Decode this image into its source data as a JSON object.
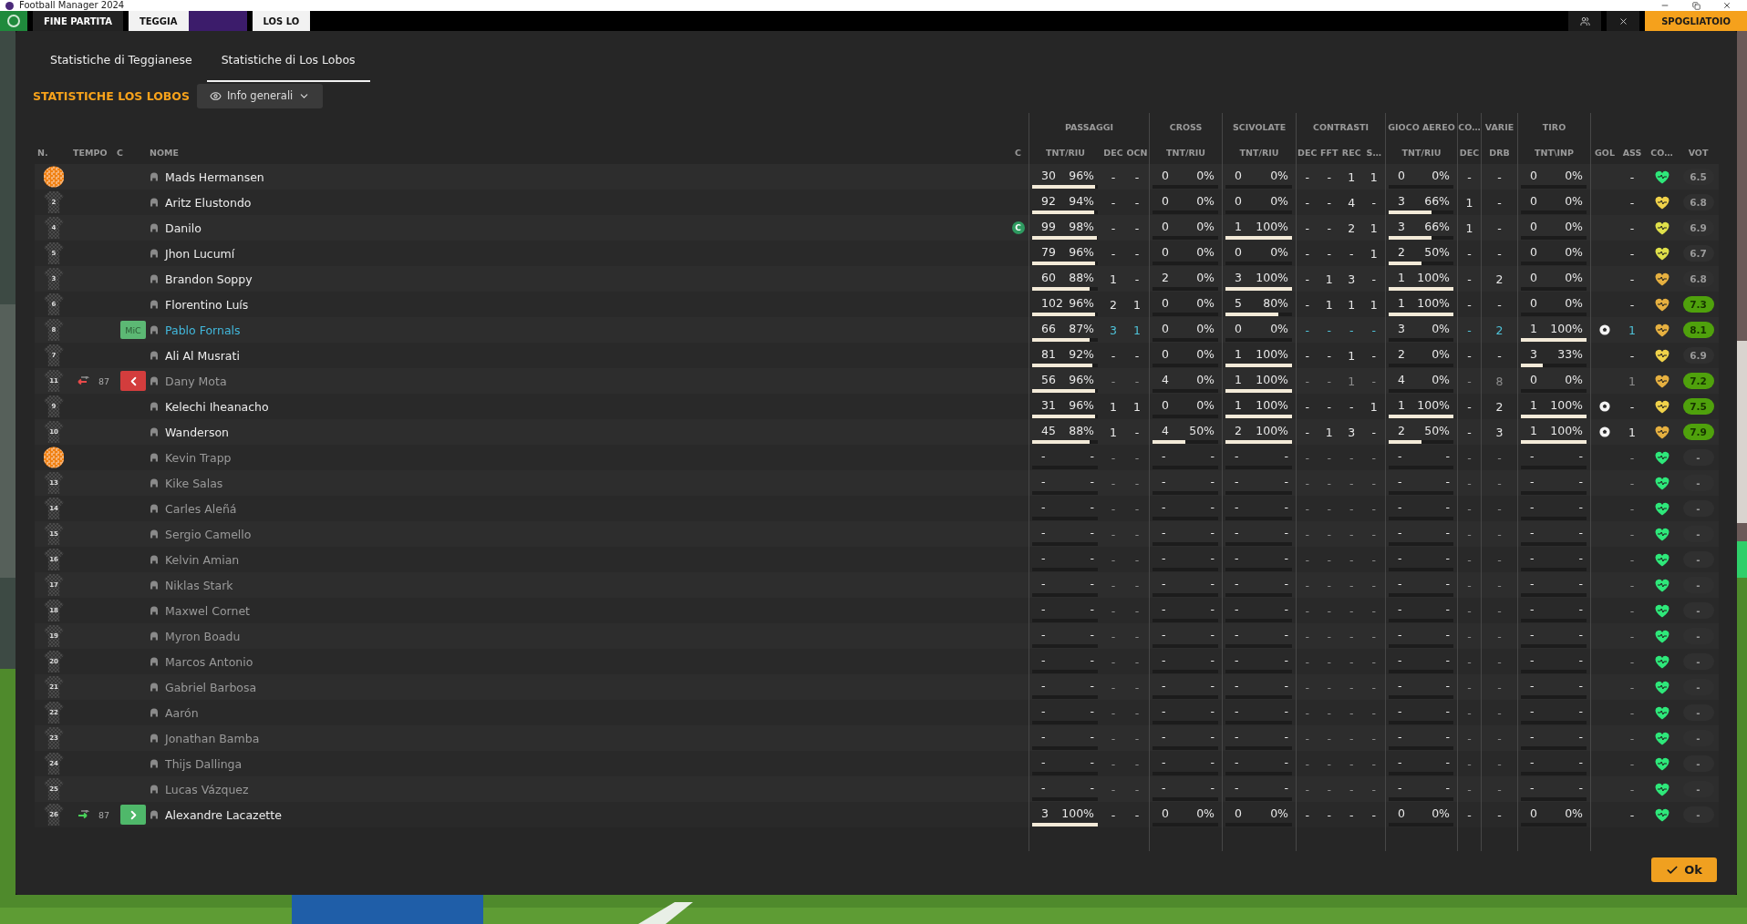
{
  "window": {
    "title": "Football Manager 2024"
  },
  "match_bar": {
    "status": "FINE PARTITA",
    "home_team": "TEGGIA",
    "away_team": "LOS LO",
    "dressing_room_button": "SPOGLIATOIO"
  },
  "tabs": [
    {
      "label": "Statistiche di Teggianese",
      "selected": false
    },
    {
      "label": "Statistiche di Los Lobos",
      "selected": true
    }
  ],
  "section_title": "STATISTICHE LOS LOBOS",
  "view_dropdown": {
    "label": "Info generali"
  },
  "column_groups": [
    "PASSAGGI",
    "CROSS",
    "SCIVOLATE",
    "CONTRASTI",
    "GIOCO AEREO",
    "CO…",
    "VARIE",
    "TIRO"
  ],
  "columns": [
    "N.",
    "TEMPO",
    "C",
    "NOME",
    "C",
    "TNT/RIU",
    "DEC",
    "OCN",
    "TNT/RIU",
    "TNT/RIU",
    "DEC",
    "FFT",
    "REC",
    "S…",
    "TNT/RIU",
    "DEC",
    "DRB",
    "TNT\\INP",
    "GOL",
    "ASS",
    "CO…",
    "VOT"
  ],
  "rows": [
    {
      "shirt": {
        "kind": "goalkeeper"
      },
      "name": "Mads Hermansen",
      "highlighted": false,
      "dimmed": false,
      "passes": {
        "tnt": "30",
        "riu": "96%",
        "level": 0.96
      },
      "dec": "-",
      "ocn": "-",
      "cross": {
        "tnt": "0",
        "riu": "0%",
        "level": 0
      },
      "tackles": {
        "tnt": "0",
        "riu": "0%",
        "level": 0
      },
      "duels": [
        "-",
        "-",
        "1",
        "1"
      ],
      "aerial": {
        "tnt": "0",
        "riu": "0%",
        "level": 0
      },
      "co_dec": "-",
      "drb": "-",
      "shots": {
        "tnt": "0",
        "riu": "0%",
        "level": 0
      },
      "goal": false,
      "ass": "-",
      "color": "#2ee87a",
      "rating": "6.5",
      "rating_good": false
    },
    {
      "shirt": {
        "kind": "outfield",
        "number": "2"
      },
      "name": "Aritz Elustondo",
      "highlighted": false,
      "dimmed": false,
      "passes": {
        "tnt": "92",
        "riu": "94%",
        "level": 0.94
      },
      "dec": "-",
      "ocn": "-",
      "cross": {
        "tnt": "0",
        "riu": "0%",
        "level": 0
      },
      "tackles": {
        "tnt": "0",
        "riu": "0%",
        "level": 0
      },
      "duels": [
        "-",
        "-",
        "4",
        "-"
      ],
      "aerial": {
        "tnt": "3",
        "riu": "66%",
        "level": 0.66
      },
      "co_dec": "1",
      "drb": "-",
      "shots": {
        "tnt": "0",
        "riu": "0%",
        "level": 0
      },
      "goal": false,
      "ass": "-",
      "color": "#f0d24a",
      "rating": "6.8",
      "rating_good": false
    },
    {
      "shirt": {
        "kind": "outfield",
        "number": "4"
      },
      "name": "Danilo",
      "captain_badge": "C",
      "highlighted": false,
      "dimmed": false,
      "passes": {
        "tnt": "99",
        "riu": "98%",
        "level": 0.98
      },
      "dec": "-",
      "ocn": "-",
      "cross": {
        "tnt": "0",
        "riu": "0%",
        "level": 0
      },
      "tackles": {
        "tnt": "1",
        "riu": "100%",
        "level": 1
      },
      "duels": [
        "-",
        "-",
        "2",
        "1"
      ],
      "aerial": {
        "tnt": "3",
        "riu": "66%",
        "level": 0.66
      },
      "co_dec": "1",
      "drb": "-",
      "shots": {
        "tnt": "0",
        "riu": "0%",
        "level": 0
      },
      "goal": false,
      "ass": "-",
      "color": "#dfe04a",
      "rating": "6.9",
      "rating_good": false
    },
    {
      "shirt": {
        "kind": "outfield",
        "number": "5"
      },
      "name": "Jhon Lucumí",
      "highlighted": false,
      "dimmed": false,
      "passes": {
        "tnt": "79",
        "riu": "96%",
        "level": 0.96
      },
      "dec": "-",
      "ocn": "-",
      "cross": {
        "tnt": "0",
        "riu": "0%",
        "level": 0
      },
      "tackles": {
        "tnt": "0",
        "riu": "0%",
        "level": 0
      },
      "duels": [
        "-",
        "-",
        "-",
        "1"
      ],
      "aerial": {
        "tnt": "2",
        "riu": "50%",
        "level": 0.5
      },
      "co_dec": "-",
      "drb": "-",
      "shots": {
        "tnt": "0",
        "riu": "0%",
        "level": 0
      },
      "goal": false,
      "ass": "-",
      "color": "#dfe04a",
      "rating": "6.7",
      "rating_good": false
    },
    {
      "shirt": {
        "kind": "outfield",
        "number": "3"
      },
      "name": "Brandon Soppy",
      "highlighted": false,
      "dimmed": false,
      "passes": {
        "tnt": "60",
        "riu": "88%",
        "level": 0.88
      },
      "dec": "1",
      "ocn": "-",
      "cross": {
        "tnt": "2",
        "riu": "0%",
        "level": 0
      },
      "tackles": {
        "tnt": "3",
        "riu": "100%",
        "level": 1
      },
      "duels": [
        "-",
        "1",
        "3",
        "-"
      ],
      "aerial": {
        "tnt": "1",
        "riu": "100%",
        "level": 1
      },
      "co_dec": "-",
      "drb": "2",
      "shots": {
        "tnt": "0",
        "riu": "0%",
        "level": 0
      },
      "goal": false,
      "ass": "-",
      "color": "#e6b040",
      "rating": "6.8",
      "rating_good": false
    },
    {
      "shirt": {
        "kind": "outfield",
        "number": "6"
      },
      "name": "Florentino Luís",
      "highlighted": false,
      "dimmed": false,
      "passes": {
        "tnt": "102",
        "riu": "96%",
        "level": 0.96
      },
      "dec": "2",
      "ocn": "1",
      "cross": {
        "tnt": "0",
        "riu": "0%",
        "level": 0
      },
      "tackles": {
        "tnt": "5",
        "riu": "80%",
        "level": 0.8
      },
      "duels": [
        "-",
        "1",
        "1",
        "1"
      ],
      "aerial": {
        "tnt": "1",
        "riu": "100%",
        "level": 1
      },
      "co_dec": "-",
      "drb": "-",
      "shots": {
        "tnt": "0",
        "riu": "0%",
        "level": 0
      },
      "goal": false,
      "ass": "-",
      "color": "#e6b040",
      "rating": "7.3",
      "rating_good": true
    },
    {
      "shirt": {
        "kind": "outfield",
        "number": "8"
      },
      "role": {
        "kind": "position",
        "label": "MiC"
      },
      "name": "Pablo Fornals",
      "highlighted": true,
      "dimmed": false,
      "passes": {
        "tnt": "66",
        "riu": "87%",
        "level": 0.87
      },
      "dec": "3",
      "ocn": "1",
      "cross": {
        "tnt": "0",
        "riu": "0%",
        "level": 0
      },
      "tackles": {
        "tnt": "0",
        "riu": "0%",
        "level": 0
      },
      "duels": [
        "-",
        "-",
        "-",
        "-"
      ],
      "aerial": {
        "tnt": "3",
        "riu": "0%",
        "level": 0
      },
      "co_dec": "-",
      "drb": "2",
      "shots": {
        "tnt": "1",
        "riu": "100%",
        "level": 1
      },
      "goal": true,
      "ass": "1",
      "color": "#e6b040",
      "rating": "8.1",
      "rating_good": true
    },
    {
      "shirt": {
        "kind": "outfield",
        "number": "7"
      },
      "name": "Ali Al Musrati",
      "highlighted": false,
      "dimmed": false,
      "passes": {
        "tnt": "81",
        "riu": "92%",
        "level": 0.92
      },
      "dec": "-",
      "ocn": "-",
      "cross": {
        "tnt": "0",
        "riu": "0%",
        "level": 0
      },
      "tackles": {
        "tnt": "1",
        "riu": "100%",
        "level": 1
      },
      "duels": [
        "-",
        "-",
        "1",
        "-"
      ],
      "aerial": {
        "tnt": "2",
        "riu": "0%",
        "level": 0
      },
      "co_dec": "-",
      "drb": "-",
      "shots": {
        "tnt": "3",
        "riu": "33%",
        "level": 0.33
      },
      "goal": false,
      "ass": "-",
      "color": "#f0d24a",
      "rating": "6.9",
      "rating_good": false
    },
    {
      "shirt": {
        "kind": "outfield",
        "number": "11"
      },
      "sub": {
        "kind": "off",
        "minute": "87"
      },
      "role": {
        "kind": "subbed_off"
      },
      "name": "Dany Mota",
      "highlighted": false,
      "dimmed": true,
      "passes": {
        "tnt": "56",
        "riu": "96%",
        "level": 0.96
      },
      "dec": "-",
      "ocn": "-",
      "cross": {
        "tnt": "4",
        "riu": "0%",
        "level": 0
      },
      "tackles": {
        "tnt": "1",
        "riu": "100%",
        "level": 1
      },
      "duels": [
        "-",
        "-",
        "1",
        "-"
      ],
      "aerial": {
        "tnt": "4",
        "riu": "0%",
        "level": 0
      },
      "co_dec": "-",
      "drb": "8",
      "shots": {
        "tnt": "0",
        "riu": "0%",
        "level": 0
      },
      "goal": false,
      "ass": "1",
      "color": "#e6b040",
      "rating": "7.2",
      "rating_good": true
    },
    {
      "shirt": {
        "kind": "outfield",
        "number": "9"
      },
      "name": "Kelechi Iheanacho",
      "highlighted": false,
      "dimmed": false,
      "passes": {
        "tnt": "31",
        "riu": "96%",
        "level": 0.96
      },
      "dec": "1",
      "ocn": "1",
      "cross": {
        "tnt": "0",
        "riu": "0%",
        "level": 0
      },
      "tackles": {
        "tnt": "1",
        "riu": "100%",
        "level": 1
      },
      "duels": [
        "-",
        "-",
        "-",
        "1"
      ],
      "aerial": {
        "tnt": "1",
        "riu": "100%",
        "level": 1
      },
      "co_dec": "-",
      "drb": "2",
      "shots": {
        "tnt": "1",
        "riu": "100%",
        "level": 1
      },
      "goal": true,
      "ass": "-",
      "color": "#f0d24a",
      "rating": "7.5",
      "rating_good": true
    },
    {
      "shirt": {
        "kind": "outfield",
        "number": "10"
      },
      "name": "Wanderson",
      "highlighted": false,
      "dimmed": false,
      "passes": {
        "tnt": "45",
        "riu": "88%",
        "level": 0.88
      },
      "dec": "1",
      "ocn": "-",
      "cross": {
        "tnt": "4",
        "riu": "50%",
        "level": 0.5
      },
      "tackles": {
        "tnt": "2",
        "riu": "100%",
        "level": 1
      },
      "duels": [
        "-",
        "1",
        "3",
        "-"
      ],
      "aerial": {
        "tnt": "2",
        "riu": "50%",
        "level": 0.5
      },
      "co_dec": "-",
      "drb": "3",
      "shots": {
        "tnt": "1",
        "riu": "100%",
        "level": 1
      },
      "goal": true,
      "ass": "1",
      "color": "#e6b040",
      "rating": "7.9",
      "rating_good": true
    },
    {
      "shirt": {
        "kind": "goalkeeper"
      },
      "name": "Kevin Trapp",
      "highlighted": false,
      "dimmed": true,
      "passes": {
        "tnt": "-",
        "riu": "-"
      },
      "dec": "-",
      "ocn": "-",
      "cross": {
        "tnt": "-",
        "riu": "-"
      },
      "tackles": {
        "tnt": "-",
        "riu": "-"
      },
      "duels": [
        "-",
        "-",
        "-",
        "-"
      ],
      "aerial": {
        "tnt": "-",
        "riu": "-"
      },
      "co_dec": "-",
      "drb": "-",
      "shots": {
        "tnt": "-",
        "riu": "-"
      },
      "goal": false,
      "ass": "-",
      "color": "#2ee87a",
      "rating": "-",
      "rating_good": false
    },
    {
      "shirt": {
        "kind": "outfield",
        "number": "13"
      },
      "name": "Kike Salas",
      "highlighted": false,
      "dimmed": true,
      "passes": {
        "tnt": "-",
        "riu": "-"
      },
      "dec": "-",
      "ocn": "-",
      "cross": {
        "tnt": "-",
        "riu": "-"
      },
      "tackles": {
        "tnt": "-",
        "riu": "-"
      },
      "duels": [
        "-",
        "-",
        "-",
        "-"
      ],
      "aerial": {
        "tnt": "-",
        "riu": "-"
      },
      "co_dec": "-",
      "drb": "-",
      "shots": {
        "tnt": "-",
        "riu": "-"
      },
      "goal": false,
      "ass": "-",
      "color": "#2ee87a",
      "rating": "-",
      "rating_good": false
    },
    {
      "shirt": {
        "kind": "outfield",
        "number": "14"
      },
      "name": "Carles Aleñá",
      "highlighted": false,
      "dimmed": true,
      "passes": {
        "tnt": "-",
        "riu": "-"
      },
      "dec": "-",
      "ocn": "-",
      "cross": {
        "tnt": "-",
        "riu": "-"
      },
      "tackles": {
        "tnt": "-",
        "riu": "-"
      },
      "duels": [
        "-",
        "-",
        "-",
        "-"
      ],
      "aerial": {
        "tnt": "-",
        "riu": "-"
      },
      "co_dec": "-",
      "drb": "-",
      "shots": {
        "tnt": "-",
        "riu": "-"
      },
      "goal": false,
      "ass": "-",
      "color": "#2ee87a",
      "rating": "-",
      "rating_good": false
    },
    {
      "shirt": {
        "kind": "outfield",
        "number": "15"
      },
      "name": "Sergio Camello",
      "highlighted": false,
      "dimmed": true,
      "passes": {
        "tnt": "-",
        "riu": "-"
      },
      "dec": "-",
      "ocn": "-",
      "cross": {
        "tnt": "-",
        "riu": "-"
      },
      "tackles": {
        "tnt": "-",
        "riu": "-"
      },
      "duels": [
        "-",
        "-",
        "-",
        "-"
      ],
      "aerial": {
        "tnt": "-",
        "riu": "-"
      },
      "co_dec": "-",
      "drb": "-",
      "shots": {
        "tnt": "-",
        "riu": "-"
      },
      "goal": false,
      "ass": "-",
      "color": "#2ee87a",
      "rating": "-",
      "rating_good": false
    },
    {
      "shirt": {
        "kind": "outfield",
        "number": "16"
      },
      "name": "Kelvin Amian",
      "highlighted": false,
      "dimmed": true,
      "passes": {
        "tnt": "-",
        "riu": "-"
      },
      "dec": "-",
      "ocn": "-",
      "cross": {
        "tnt": "-",
        "riu": "-"
      },
      "tackles": {
        "tnt": "-",
        "riu": "-"
      },
      "duels": [
        "-",
        "-",
        "-",
        "-"
      ],
      "aerial": {
        "tnt": "-",
        "riu": "-"
      },
      "co_dec": "-",
      "drb": "-",
      "shots": {
        "tnt": "-",
        "riu": "-"
      },
      "goal": false,
      "ass": "-",
      "color": "#2ee87a",
      "rating": "-",
      "rating_good": false
    },
    {
      "shirt": {
        "kind": "outfield",
        "number": "17"
      },
      "name": "Niklas Stark",
      "highlighted": false,
      "dimmed": true,
      "passes": {
        "tnt": "-",
        "riu": "-"
      },
      "dec": "-",
      "ocn": "-",
      "cross": {
        "tnt": "-",
        "riu": "-"
      },
      "tackles": {
        "tnt": "-",
        "riu": "-"
      },
      "duels": [
        "-",
        "-",
        "-",
        "-"
      ],
      "aerial": {
        "tnt": "-",
        "riu": "-"
      },
      "co_dec": "-",
      "drb": "-",
      "shots": {
        "tnt": "-",
        "riu": "-"
      },
      "goal": false,
      "ass": "-",
      "color": "#2ee87a",
      "rating": "-",
      "rating_good": false
    },
    {
      "shirt": {
        "kind": "outfield",
        "number": "18"
      },
      "name": "Maxwel Cornet",
      "highlighted": false,
      "dimmed": true,
      "passes": {
        "tnt": "-",
        "riu": "-"
      },
      "dec": "-",
      "ocn": "-",
      "cross": {
        "tnt": "-",
        "riu": "-"
      },
      "tackles": {
        "tnt": "-",
        "riu": "-"
      },
      "duels": [
        "-",
        "-",
        "-",
        "-"
      ],
      "aerial": {
        "tnt": "-",
        "riu": "-"
      },
      "co_dec": "-",
      "drb": "-",
      "shots": {
        "tnt": "-",
        "riu": "-"
      },
      "goal": false,
      "ass": "-",
      "color": "#2ee87a",
      "rating": "-",
      "rating_good": false
    },
    {
      "shirt": {
        "kind": "outfield",
        "number": "19"
      },
      "name": "Myron Boadu",
      "highlighted": false,
      "dimmed": true,
      "passes": {
        "tnt": "-",
        "riu": "-"
      },
      "dec": "-",
      "ocn": "-",
      "cross": {
        "tnt": "-",
        "riu": "-"
      },
      "tackles": {
        "tnt": "-",
        "riu": "-"
      },
      "duels": [
        "-",
        "-",
        "-",
        "-"
      ],
      "aerial": {
        "tnt": "-",
        "riu": "-"
      },
      "co_dec": "-",
      "drb": "-",
      "shots": {
        "tnt": "-",
        "riu": "-"
      },
      "goal": false,
      "ass": "-",
      "color": "#2ee87a",
      "rating": "-",
      "rating_good": false
    },
    {
      "shirt": {
        "kind": "outfield",
        "number": "20"
      },
      "name": "Marcos Antonio",
      "highlighted": false,
      "dimmed": true,
      "passes": {
        "tnt": "-",
        "riu": "-"
      },
      "dec": "-",
      "ocn": "-",
      "cross": {
        "tnt": "-",
        "riu": "-"
      },
      "tackles": {
        "tnt": "-",
        "riu": "-"
      },
      "duels": [
        "-",
        "-",
        "-",
        "-"
      ],
      "aerial": {
        "tnt": "-",
        "riu": "-"
      },
      "co_dec": "-",
      "drb": "-",
      "shots": {
        "tnt": "-",
        "riu": "-"
      },
      "goal": false,
      "ass": "-",
      "color": "#2ee87a",
      "rating": "-",
      "rating_good": false
    },
    {
      "shirt": {
        "kind": "outfield",
        "number": "21"
      },
      "name": "Gabriel Barbosa",
      "highlighted": false,
      "dimmed": true,
      "passes": {
        "tnt": "-",
        "riu": "-"
      },
      "dec": "-",
      "ocn": "-",
      "cross": {
        "tnt": "-",
        "riu": "-"
      },
      "tackles": {
        "tnt": "-",
        "riu": "-"
      },
      "duels": [
        "-",
        "-",
        "-",
        "-"
      ],
      "aerial": {
        "tnt": "-",
        "riu": "-"
      },
      "co_dec": "-",
      "drb": "-",
      "shots": {
        "tnt": "-",
        "riu": "-"
      },
      "goal": false,
      "ass": "-",
      "color": "#2ee87a",
      "rating": "-",
      "rating_good": false
    },
    {
      "shirt": {
        "kind": "outfield",
        "number": "22"
      },
      "name": "Aarón",
      "highlighted": false,
      "dimmed": true,
      "passes": {
        "tnt": "-",
        "riu": "-"
      },
      "dec": "-",
      "ocn": "-",
      "cross": {
        "tnt": "-",
        "riu": "-"
      },
      "tackles": {
        "tnt": "-",
        "riu": "-"
      },
      "duels": [
        "-",
        "-",
        "-",
        "-"
      ],
      "aerial": {
        "tnt": "-",
        "riu": "-"
      },
      "co_dec": "-",
      "drb": "-",
      "shots": {
        "tnt": "-",
        "riu": "-"
      },
      "goal": false,
      "ass": "-",
      "color": "#2ee87a",
      "rating": "-",
      "rating_good": false
    },
    {
      "shirt": {
        "kind": "outfield",
        "number": "23"
      },
      "name": "Jonathan Bamba",
      "highlighted": false,
      "dimmed": true,
      "passes": {
        "tnt": "-",
        "riu": "-"
      },
      "dec": "-",
      "ocn": "-",
      "cross": {
        "tnt": "-",
        "riu": "-"
      },
      "tackles": {
        "tnt": "-",
        "riu": "-"
      },
      "duels": [
        "-",
        "-",
        "-",
        "-"
      ],
      "aerial": {
        "tnt": "-",
        "riu": "-"
      },
      "co_dec": "-",
      "drb": "-",
      "shots": {
        "tnt": "-",
        "riu": "-"
      },
      "goal": false,
      "ass": "-",
      "color": "#2ee87a",
      "rating": "-",
      "rating_good": false
    },
    {
      "shirt": {
        "kind": "outfield",
        "number": "24"
      },
      "name": "Thijs Dallinga",
      "highlighted": false,
      "dimmed": true,
      "passes": {
        "tnt": "-",
        "riu": "-"
      },
      "dec": "-",
      "ocn": "-",
      "cross": {
        "tnt": "-",
        "riu": "-"
      },
      "tackles": {
        "tnt": "-",
        "riu": "-"
      },
      "duels": [
        "-",
        "-",
        "-",
        "-"
      ],
      "aerial": {
        "tnt": "-",
        "riu": "-"
      },
      "co_dec": "-",
      "drb": "-",
      "shots": {
        "tnt": "-",
        "riu": "-"
      },
      "goal": false,
      "ass": "-",
      "color": "#2ee87a",
      "rating": "-",
      "rating_good": false
    },
    {
      "shirt": {
        "kind": "outfield",
        "number": "25"
      },
      "name": "Lucas Vázquez",
      "highlighted": false,
      "dimmed": true,
      "passes": {
        "tnt": "-",
        "riu": "-"
      },
      "dec": "-",
      "ocn": "-",
      "cross": {
        "tnt": "-",
        "riu": "-"
      },
      "tackles": {
        "tnt": "-",
        "riu": "-"
      },
      "duels": [
        "-",
        "-",
        "-",
        "-"
      ],
      "aerial": {
        "tnt": "-",
        "riu": "-"
      },
      "co_dec": "-",
      "drb": "-",
      "shots": {
        "tnt": "-",
        "riu": "-"
      },
      "goal": false,
      "ass": "-",
      "color": "#2ee87a",
      "rating": "-",
      "rating_good": false
    },
    {
      "shirt": {
        "kind": "outfield",
        "number": "26"
      },
      "sub": {
        "kind": "on",
        "minute": "87"
      },
      "role": {
        "kind": "subbed_on"
      },
      "name": "Alexandre Lacazette",
      "highlighted": false,
      "dimmed": false,
      "passes": {
        "tnt": "3",
        "riu": "100%",
        "level": 1
      },
      "dec": "-",
      "ocn": "-",
      "cross": {
        "tnt": "0",
        "riu": "0%",
        "level": 0
      },
      "tackles": {
        "tnt": "0",
        "riu": "0%",
        "level": 0
      },
      "duels": [
        "-",
        "-",
        "-",
        "-"
      ],
      "aerial": {
        "tnt": "0",
        "riu": "0%",
        "level": 0
      },
      "co_dec": "-",
      "drb": "-",
      "shots": {
        "tnt": "0",
        "riu": "0%",
        "level": 0
      },
      "goal": false,
      "ass": "-",
      "color": "#2ee87a",
      "rating": "-",
      "rating_good": false
    }
  ],
  "ok_button": "Ok"
}
